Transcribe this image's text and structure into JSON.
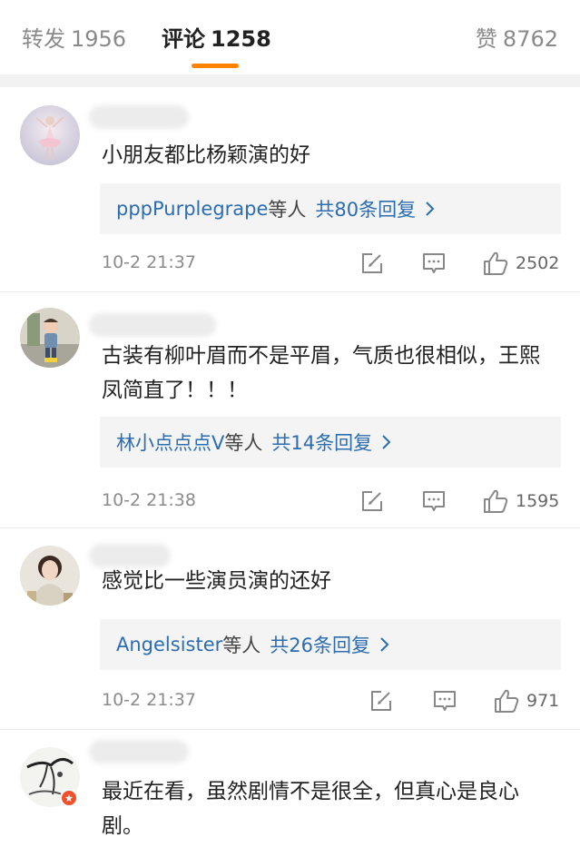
{
  "tabs": {
    "forward_label": "转发",
    "forward_count": "1956",
    "comments_label": "评论",
    "comments_count": "1258",
    "likes_label": "赞",
    "likes_count": "8762"
  },
  "colors": {
    "accent": "#ff8200",
    "link": "#2c6cb0",
    "divider": "#f2f2f2",
    "badge": "#f0502a"
  },
  "comments": [
    {
      "text": "小朋友都比杨颖演的好",
      "reply_users": "pppPurplegrape",
      "reply_suffix": "等人",
      "reply_count": "共80条回复",
      "time": "10-2 21:37",
      "likes": "2502",
      "avatar_icon": "ballerina-avatar"
    },
    {
      "text": "古装有柳叶眉而不是平眉，气质也很相似，王熙凤简直了！！！",
      "reply_users": "林小点点点V",
      "reply_suffix": "等人",
      "reply_count": "共14条回复",
      "time": "10-2 21:38",
      "likes": "1595",
      "avatar_icon": "child-avatar"
    },
    {
      "text": "感觉比一些演员演的还好",
      "reply_users": "Angelsister",
      "reply_suffix": "等人",
      "reply_count": "共26条回复",
      "time": "10-2 21:37",
      "likes": "971",
      "avatar_icon": "woman-avatar"
    },
    {
      "text": "最近在看，虽然剧情不是很全，但真心是良心剧。",
      "avatar_icon": "ink-painting-avatar"
    }
  ]
}
